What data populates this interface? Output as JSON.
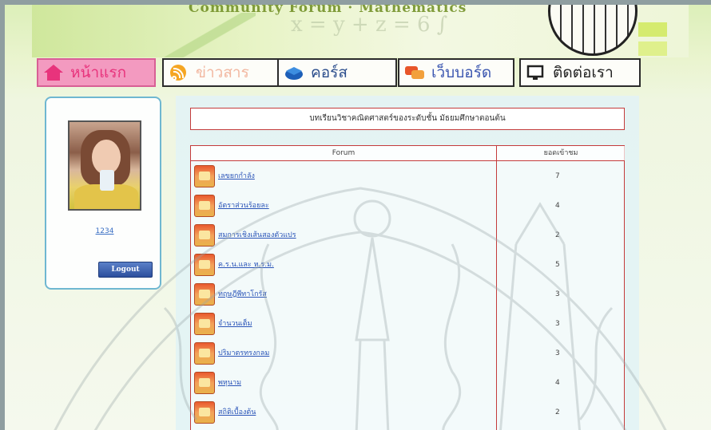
{
  "banner": {
    "title": "Community Forum · Mathematics",
    "math_text": "x = y + z = 6 ∫"
  },
  "nav": {
    "home": "หน้าแรก",
    "news": "ข่าวสาร",
    "course": "คอร์ส",
    "webboard": "เว็บบอร์ด",
    "contact": "ติดต่อเรา"
  },
  "profile": {
    "username": "1234",
    "logout_label": "Logout"
  },
  "content": {
    "course_title": "บทเรียนวิชาคณิตศาสตร์ของระดับชั้น มัธยมศึกษาตอนต้น",
    "header_forum": "Forum",
    "header_count": "ยอดเข้าชม",
    "forums": [
      {
        "name": "เลขยกกำลัง",
        "count": "7"
      },
      {
        "name": "อัตราส่วนร้อยละ",
        "count": "4"
      },
      {
        "name": "สมการเชิงเส้นสองตัวแปร",
        "count": "2"
      },
      {
        "name": "ค.ร.น.และ ห.ร.ม.",
        "count": "5"
      },
      {
        "name": "ทฤษฎีพีทาโกรัส",
        "count": "3"
      },
      {
        "name": "จำนวนเต็ม",
        "count": "3"
      },
      {
        "name": "ปริมาตรทรงกลม",
        "count": "3"
      },
      {
        "name": "พหุนาม",
        "count": "4"
      },
      {
        "name": "สถิติเบื้องต้น",
        "count": "2"
      }
    ]
  },
  "colors": {
    "accent_red": "#c43b3b",
    "link_blue": "#2a54b8",
    "nav_home_bg": "#f39ac0",
    "panel_border": "#6fb7d1"
  }
}
